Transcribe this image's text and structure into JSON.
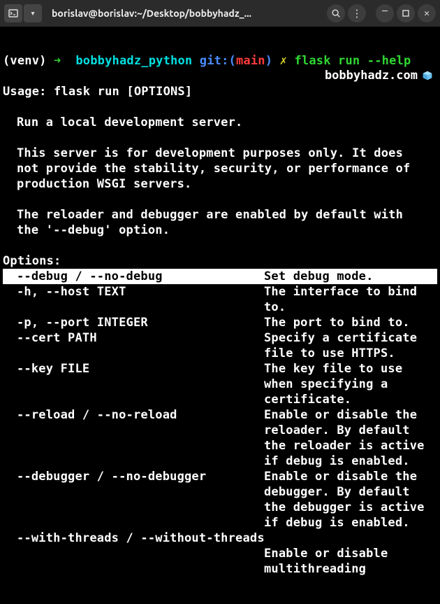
{
  "titlebar": {
    "title": "borislav@borislav:~/Desktop/bobbyhadz_..."
  },
  "watermark": "bobbyhadz.com",
  "prompt": {
    "venv": "(venv)",
    "arrow": "➜",
    "bold_arrow": "➜",
    "dir": "bobbyhadz_python",
    "git_label": "git:(",
    "branch": "main",
    "git_close": ")",
    "cmd_symbol": "✗",
    "command": "flask run --help",
    "partial_command": ";"
  },
  "usage": "Usage: flask run [OPTIONS]",
  "desc1": "Run a local development server.",
  "desc2": "This server is for development purposes only. It does not provide the stability, security, or performance of production WSGI servers.",
  "desc3": "The reloader and debugger are enabled by default with the '--debug' option.",
  "options_header": "Options:",
  "options": [
    {
      "flag": "--debug / --no-debug",
      "desc": "Set debug mode.",
      "hl": true
    },
    {
      "flag": "-h, --host TEXT",
      "desc": "The interface to bind to."
    },
    {
      "flag": "-p, --port INTEGER",
      "desc": "The port to bind to."
    },
    {
      "flag": "--cert PATH",
      "desc": "Specify a certificate file to use HTTPS."
    },
    {
      "flag": "--key FILE",
      "desc": "The key file to use when specifying a certificate."
    },
    {
      "flag": "--reload / --no-reload",
      "desc": "Enable or disable the reloader. By default the reloader is active if debug is enabled."
    },
    {
      "flag": "--debugger / --no-debugger",
      "desc": "Enable or disable the debugger. By default the debugger is active if debug is enabled."
    },
    {
      "flag": "--with-threads / --without-threads",
      "desc": "Enable or disable multithreading"
    }
  ]
}
